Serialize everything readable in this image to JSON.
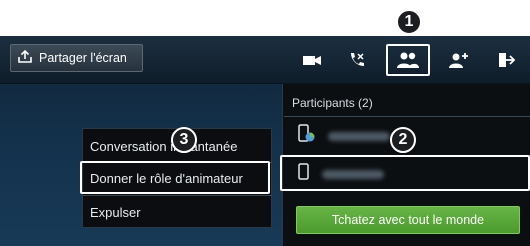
{
  "toolbar": {
    "share_label": "Partager l'écran",
    "icons": [
      "share-screen-icon",
      "video-icon",
      "end-call-icon",
      "participants-icon",
      "add-participant-icon",
      "exit-icon"
    ]
  },
  "participants_panel": {
    "header": "Participants (2)",
    "chat_all_label": "Tchatez avec tout le monde"
  },
  "context_menu": {
    "items": [
      "Conversation instantanée",
      "Donner le rôle d'animateur",
      "Expulser"
    ]
  },
  "callouts": [
    "1",
    "2",
    "3"
  ],
  "colors": {
    "accent_green": "#5aa83a",
    "highlight": "#ffffff"
  }
}
